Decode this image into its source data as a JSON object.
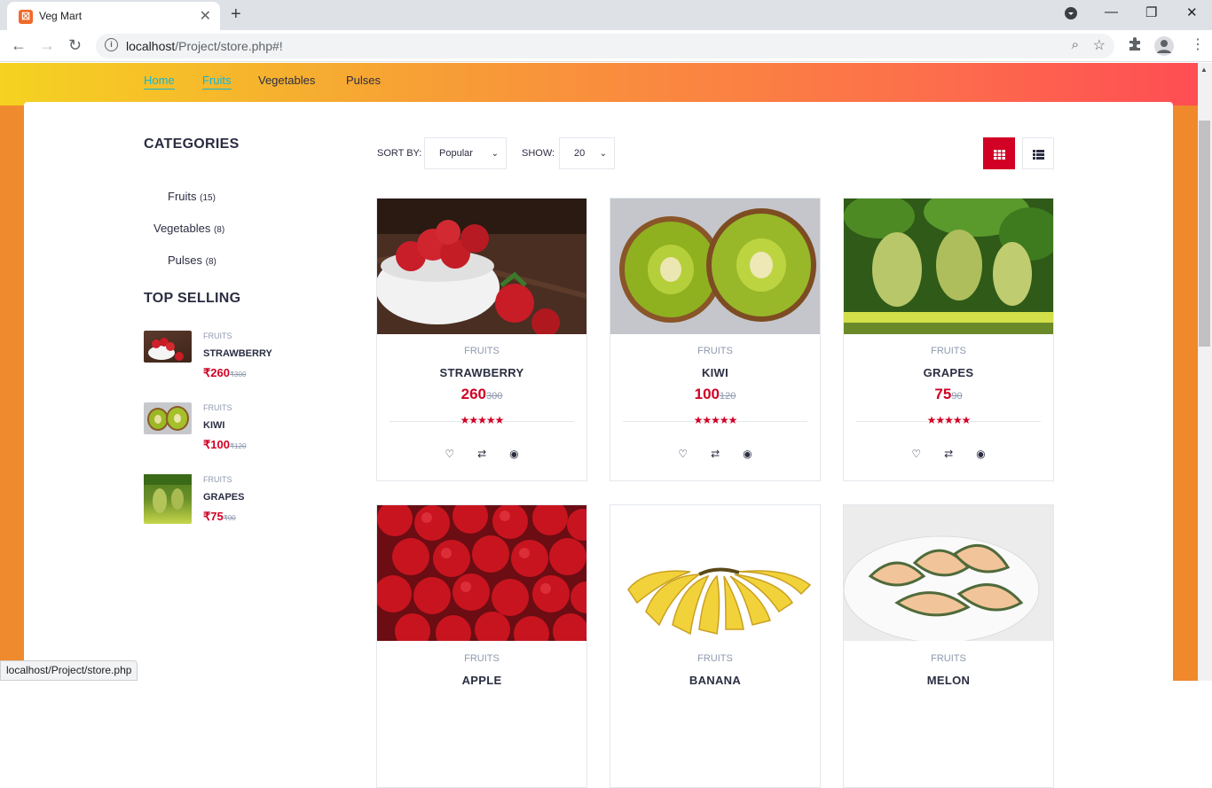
{
  "browser": {
    "tab_title": "Veg Mart",
    "url_host": "localhost",
    "url_path": "/Project/store.php#!",
    "status_url": "localhost/Project/store.php"
  },
  "nav": {
    "items": [
      {
        "label": "Home"
      },
      {
        "label": "Fruits"
      },
      {
        "label": "Vegetables"
      },
      {
        "label": "Pulses"
      }
    ]
  },
  "aside": {
    "categories_title": "CATEGORIES",
    "categories": [
      {
        "name": "Fruits",
        "count": "(15)"
      },
      {
        "name": "Vegetables",
        "count": "(8)"
      },
      {
        "name": "Pulses",
        "count": "(8)"
      }
    ],
    "top_selling_title": "TOP SELLING",
    "top_selling": [
      {
        "category": "FRUITS",
        "name": "STRAWBERRY",
        "price": "₹260",
        "old": "₹300"
      },
      {
        "category": "FRUITS",
        "name": "KIWI",
        "price": "₹100",
        "old": "₹120"
      },
      {
        "category": "FRUITS",
        "name": "GRAPES",
        "price": "₹75",
        "old": "₹90"
      }
    ]
  },
  "store": {
    "sort_label": "SORT BY:",
    "sort_value": "Popular",
    "show_label": "SHOW:",
    "show_value": "20"
  },
  "products": [
    {
      "category": "FRUITS",
      "name": "STRAWBERRY",
      "price": "260",
      "old": "300",
      "rating": 5
    },
    {
      "category": "FRUITS",
      "name": "KIWI",
      "price": "100",
      "old": "120",
      "rating": 5
    },
    {
      "category": "FRUITS",
      "name": "GRAPES",
      "price": "75",
      "old": "90",
      "rating": 5
    },
    {
      "category": "FRUITS",
      "name": "APPLE"
    },
    {
      "category": "FRUITS",
      "name": "BANANA"
    },
    {
      "category": "FRUITS",
      "name": "MELON"
    }
  ]
}
